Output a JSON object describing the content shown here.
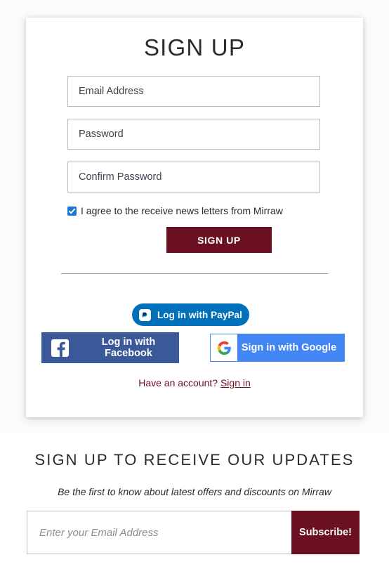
{
  "colors": {
    "brand_maroon": "#6b1020",
    "paypal_blue": "#0070ba",
    "facebook_blue": "#3b5998",
    "google_blue": "#4285f4",
    "checkbox_blue": "#1877d2"
  },
  "signup": {
    "title": "SIGN UP",
    "fields": {
      "email_placeholder": "Email Address",
      "password_placeholder": "Password",
      "confirm_placeholder": "Confirm Password"
    },
    "agree_label": "I agree to the receive news letters from Mirraw",
    "submit_label": "SIGN UP",
    "social": {
      "paypal_label": "Log in with PayPal",
      "facebook_label": "Log in with Facebook",
      "google_label": "Sign in with Google"
    },
    "account_prompt": "Have an account?",
    "signin_label": "Sign in"
  },
  "newsletter": {
    "title": "SIGN UP TO RECEIVE OUR UPDATES",
    "subtitle": "Be the first to know about latest offers and discounts on Mirraw",
    "email_placeholder": "Enter your Email Address",
    "subscribe_label": "Subscribe!"
  }
}
